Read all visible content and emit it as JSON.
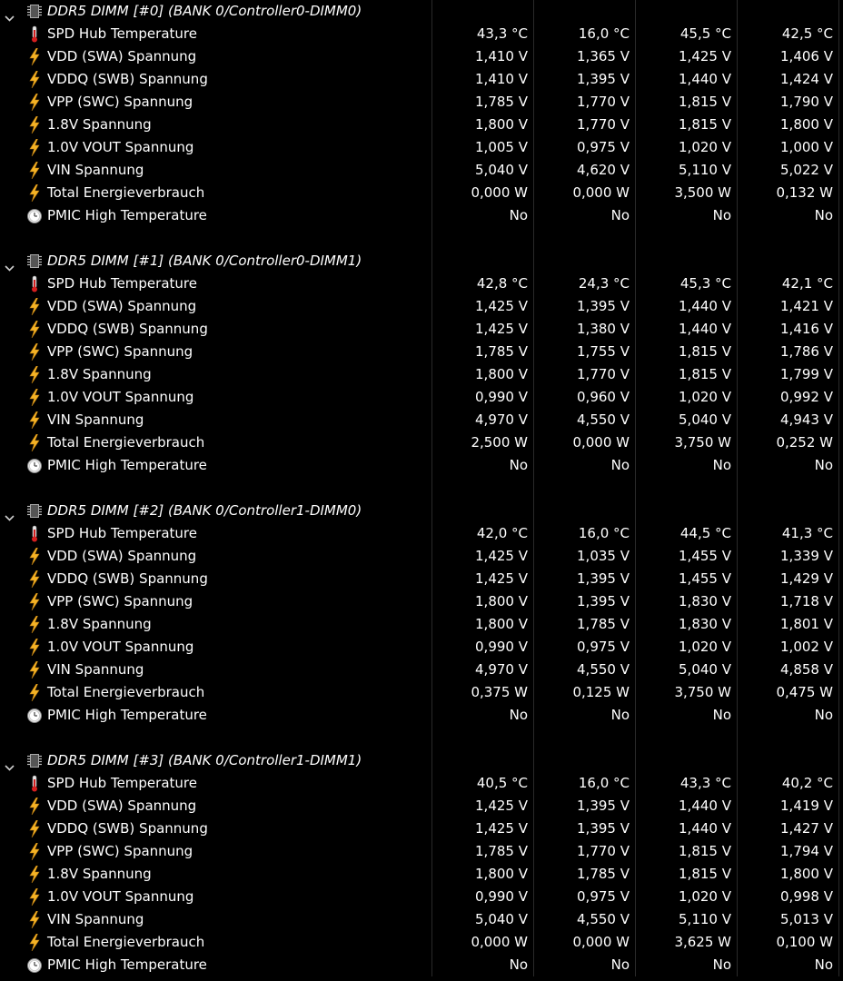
{
  "colors": {
    "background": "#000000",
    "text": "#ffffff",
    "divider": "#2a2a2a",
    "bolt": "#f5b325",
    "thermometer": "#d41f1f"
  },
  "icons": {
    "group": "memory-chip-icon",
    "temperature": "thermometer-icon",
    "voltage": "lightning-bolt-icon",
    "power": "lightning-bolt-icon",
    "status": "clock-gauge-icon",
    "expand": "chevron-down-icon"
  },
  "groups": [
    {
      "title": "DDR5 DIMM [#0] (BANK 0/Controller0-DIMM0)",
      "rows": [
        {
          "label": "SPD Hub Temperature",
          "icon": "temperature",
          "values": [
            "43,3 °C",
            "16,0 °C",
            "45,5 °C",
            "42,5 °C"
          ]
        },
        {
          "label": "VDD (SWA) Spannung",
          "icon": "voltage",
          "values": [
            "1,410 V",
            "1,365 V",
            "1,425 V",
            "1,406 V"
          ]
        },
        {
          "label": "VDDQ (SWB) Spannung",
          "icon": "voltage",
          "values": [
            "1,410 V",
            "1,395 V",
            "1,440 V",
            "1,424 V"
          ]
        },
        {
          "label": "VPP (SWC) Spannung",
          "icon": "voltage",
          "values": [
            "1,785 V",
            "1,770 V",
            "1,815 V",
            "1,790 V"
          ]
        },
        {
          "label": "1.8V Spannung",
          "icon": "voltage",
          "values": [
            "1,800 V",
            "1,770 V",
            "1,815 V",
            "1,800 V"
          ]
        },
        {
          "label": "1.0V VOUT Spannung",
          "icon": "voltage",
          "values": [
            "1,005 V",
            "0,975 V",
            "1,020 V",
            "1,000 V"
          ]
        },
        {
          "label": "VIN Spannung",
          "icon": "voltage",
          "values": [
            "5,040 V",
            "4,620 V",
            "5,110 V",
            "5,022 V"
          ]
        },
        {
          "label": "Total Energieverbrauch",
          "icon": "power",
          "values": [
            "0,000 W",
            "0,000 W",
            "3,500 W",
            "0,132 W"
          ]
        },
        {
          "label": "PMIC High Temperature",
          "icon": "status",
          "values": [
            "No",
            "No",
            "No",
            "No"
          ]
        }
      ]
    },
    {
      "title": "DDR5 DIMM [#1] (BANK 0/Controller0-DIMM1)",
      "rows": [
        {
          "label": "SPD Hub Temperature",
          "icon": "temperature",
          "values": [
            "42,8 °C",
            "24,3 °C",
            "45,3 °C",
            "42,1 °C"
          ]
        },
        {
          "label": "VDD (SWA) Spannung",
          "icon": "voltage",
          "values": [
            "1,425 V",
            "1,395 V",
            "1,440 V",
            "1,421 V"
          ]
        },
        {
          "label": "VDDQ (SWB) Spannung",
          "icon": "voltage",
          "values": [
            "1,425 V",
            "1,380 V",
            "1,440 V",
            "1,416 V"
          ]
        },
        {
          "label": "VPP (SWC) Spannung",
          "icon": "voltage",
          "values": [
            "1,785 V",
            "1,755 V",
            "1,815 V",
            "1,786 V"
          ]
        },
        {
          "label": "1.8V Spannung",
          "icon": "voltage",
          "values": [
            "1,800 V",
            "1,770 V",
            "1,815 V",
            "1,799 V"
          ]
        },
        {
          "label": "1.0V VOUT Spannung",
          "icon": "voltage",
          "values": [
            "0,990 V",
            "0,960 V",
            "1,020 V",
            "0,992 V"
          ]
        },
        {
          "label": "VIN Spannung",
          "icon": "voltage",
          "values": [
            "4,970 V",
            "4,550 V",
            "5,040 V",
            "4,943 V"
          ]
        },
        {
          "label": "Total Energieverbrauch",
          "icon": "power",
          "values": [
            "2,500 W",
            "0,000 W",
            "3,750 W",
            "0,252 W"
          ]
        },
        {
          "label": "PMIC High Temperature",
          "icon": "status",
          "values": [
            "No",
            "No",
            "No",
            "No"
          ]
        }
      ]
    },
    {
      "title": "DDR5 DIMM [#2] (BANK 0/Controller1-DIMM0)",
      "rows": [
        {
          "label": "SPD Hub Temperature",
          "icon": "temperature",
          "values": [
            "42,0 °C",
            "16,0 °C",
            "44,5 °C",
            "41,3 °C"
          ]
        },
        {
          "label": "VDD (SWA) Spannung",
          "icon": "voltage",
          "values": [
            "1,425 V",
            "1,035 V",
            "1,455 V",
            "1,339 V"
          ]
        },
        {
          "label": "VDDQ (SWB) Spannung",
          "icon": "voltage",
          "values": [
            "1,425 V",
            "1,395 V",
            "1,455 V",
            "1,429 V"
          ]
        },
        {
          "label": "VPP (SWC) Spannung",
          "icon": "voltage",
          "values": [
            "1,800 V",
            "1,395 V",
            "1,830 V",
            "1,718 V"
          ]
        },
        {
          "label": "1.8V Spannung",
          "icon": "voltage",
          "values": [
            "1,800 V",
            "1,785 V",
            "1,830 V",
            "1,801 V"
          ]
        },
        {
          "label": "1.0V VOUT Spannung",
          "icon": "voltage",
          "values": [
            "0,990 V",
            "0,975 V",
            "1,020 V",
            "1,002 V"
          ]
        },
        {
          "label": "VIN Spannung",
          "icon": "voltage",
          "values": [
            "4,970 V",
            "4,550 V",
            "5,040 V",
            "4,858 V"
          ]
        },
        {
          "label": "Total Energieverbrauch",
          "icon": "power",
          "values": [
            "0,375 W",
            "0,125 W",
            "3,750 W",
            "0,475 W"
          ]
        },
        {
          "label": "PMIC High Temperature",
          "icon": "status",
          "values": [
            "No",
            "No",
            "No",
            "No"
          ]
        }
      ]
    },
    {
      "title": "DDR5 DIMM [#3] (BANK 0/Controller1-DIMM1)",
      "rows": [
        {
          "label": "SPD Hub Temperature",
          "icon": "temperature",
          "values": [
            "40,5 °C",
            "16,0 °C",
            "43,3 °C",
            "40,2 °C"
          ]
        },
        {
          "label": "VDD (SWA) Spannung",
          "icon": "voltage",
          "values": [
            "1,425 V",
            "1,395 V",
            "1,440 V",
            "1,419 V"
          ]
        },
        {
          "label": "VDDQ (SWB) Spannung",
          "icon": "voltage",
          "values": [
            "1,425 V",
            "1,395 V",
            "1,440 V",
            "1,427 V"
          ]
        },
        {
          "label": "VPP (SWC) Spannung",
          "icon": "voltage",
          "values": [
            "1,785 V",
            "1,770 V",
            "1,815 V",
            "1,794 V"
          ]
        },
        {
          "label": "1.8V Spannung",
          "icon": "voltage",
          "values": [
            "1,800 V",
            "1,785 V",
            "1,815 V",
            "1,800 V"
          ]
        },
        {
          "label": "1.0V VOUT Spannung",
          "icon": "voltage",
          "values": [
            "0,990 V",
            "0,975 V",
            "1,020 V",
            "0,998 V"
          ]
        },
        {
          "label": "VIN Spannung",
          "icon": "voltage",
          "values": [
            "5,040 V",
            "4,550 V",
            "5,110 V",
            "5,013 V"
          ]
        },
        {
          "label": "Total Energieverbrauch",
          "icon": "power",
          "values": [
            "0,000 W",
            "0,000 W",
            "3,625 W",
            "0,100 W"
          ]
        },
        {
          "label": "PMIC High Temperature",
          "icon": "status",
          "values": [
            "No",
            "No",
            "No",
            "No"
          ]
        }
      ]
    }
  ]
}
